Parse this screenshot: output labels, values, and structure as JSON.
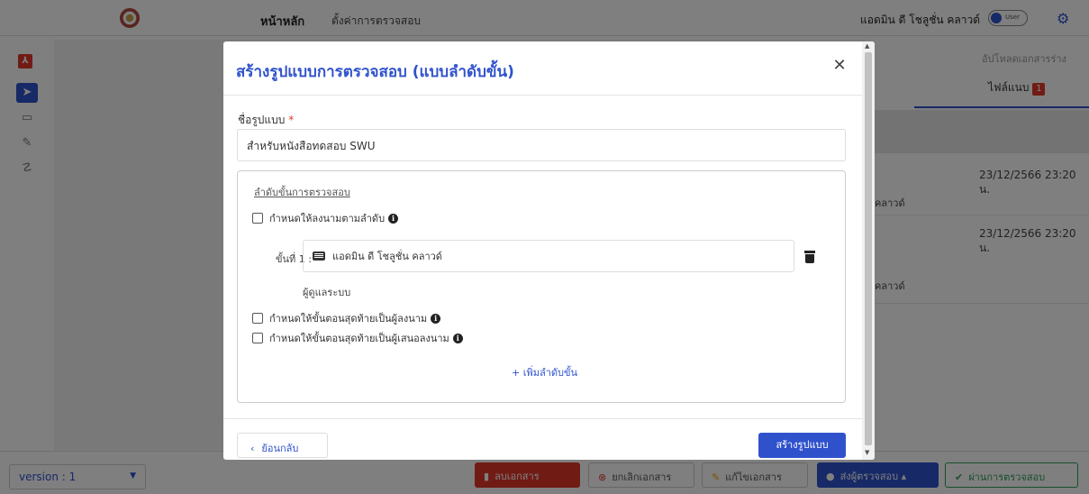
{
  "topbar": {
    "nav_home": "หน้าหลัก",
    "nav_settings": "ตั้งค่าการตรวจสอบ",
    "user_name": "แอดมิน ดี โชลูชั่น คลาวด์",
    "toggle_label": "User"
  },
  "right_panel": {
    "upload_draft": "อัปโหลดเอกสารร่าง",
    "files_tab": "ไฟล์แนบ",
    "files_count": "1",
    "entries": [
      {
        "date": "23/12/2566 23:20 น.",
        "name": "น คลาวด์"
      },
      {
        "date": "23/12/2566 23:20 น.",
        "name": "น คลาวด์"
      }
    ]
  },
  "footer": {
    "version": "version : 1",
    "delete_doc": "ลบเอกสาร",
    "cancel_doc": "ยกเลิกเอกสาร",
    "edit_doc": "แก้ไขเอกสาร",
    "send_review": "ส่งผู้ตรวจสอบ",
    "pass_review": "ผ่านการตรวจสอบ"
  },
  "modal": {
    "title": "สร้างรูปแบบการตรวจสอบ (แบบลำดับขั้น)",
    "name_label": "ชื่อรูปแบบ",
    "name_required": "*",
    "name_value": "สำหรับหนังสือทดสอบ SWU",
    "steps_title": "ลำดับขั้นการตรวจสอบ",
    "option_sign_in_order": "กำหนดให้ลงนามตามลำดับ",
    "step_label": "ขั้นที่ 1 :",
    "step_value": "แอดมิน ดี โชลูชั่น คลาวด์",
    "step_role": "ผู้ดูแลระบบ",
    "option_last_signer": "กำหนดให้ขั้นตอนสุดท้ายเป็นผู้ลงนาม",
    "option_last_proposer": "กำหนดให้ขั้นตอนสุดท้ายเป็นผู้เสนอลงนาม",
    "add_step": "+ เพิ่มลำดับขั้น",
    "back": "ย้อนกลับ",
    "create": "สร้างรูปแบบ"
  },
  "colors": {
    "accent": "#2f52cc",
    "danger": "#e0382b",
    "success": "#2e9e5b"
  }
}
